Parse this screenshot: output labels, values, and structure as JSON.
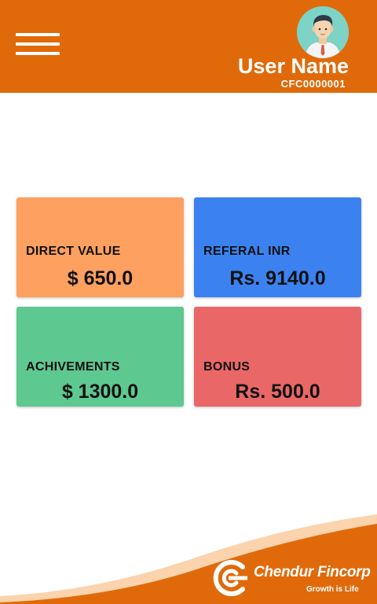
{
  "header": {
    "user_name": "User Name",
    "user_id": "CFC0000001",
    "background_color": "#e06a0a",
    "menu_icon": "hamburger-menu-icon",
    "avatar_icon": "user-avatar-icon"
  },
  "cards": [
    {
      "label": "DIRECT VALUE",
      "value": "$ 650.0",
      "color": "#fda060"
    },
    {
      "label": "REFERAL INR",
      "value": "Rs. 9140.0",
      "color": "#3b82f0"
    },
    {
      "label": "ACHIVEMENTS",
      "value": "$ 1300.0",
      "color": "#5ec891"
    },
    {
      "label": "BONUS",
      "value": "Rs. 500.0",
      "color": "#ea6767"
    }
  ],
  "footer": {
    "brand_name": "Chendur Fincorp",
    "tagline": "Growth is Life",
    "brand_color": "#e06a0a",
    "logo_icon": "chendur-fincorp-logo-icon"
  }
}
